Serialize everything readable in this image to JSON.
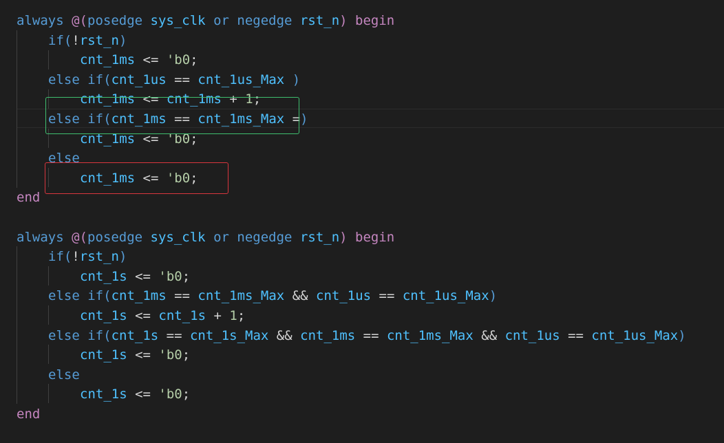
{
  "colors": {
    "background": "#1e1e1e",
    "keyword": "#569cd6",
    "control": "#c586c0",
    "variable": "#4fc1ff",
    "number": "#b5cea8",
    "operator": "#d4d4d4",
    "annotation_green": "#3fbf6f",
    "annotation_red": "#d9363e"
  },
  "code": {
    "lines": [
      {
        "indent": 0,
        "tokens": [
          [
            "always",
            "tok-kw"
          ],
          [
            " ",
            ""
          ],
          [
            "@",
            "tok-at"
          ],
          [
            "(",
            "tok-brk2"
          ],
          [
            "posedge",
            "tok-kw"
          ],
          [
            " ",
            ""
          ],
          [
            "sys_clk",
            "tok-var"
          ],
          [
            " ",
            ""
          ],
          [
            "or",
            "tok-kw"
          ],
          [
            " ",
            ""
          ],
          [
            "negedge",
            "tok-kw"
          ],
          [
            " ",
            ""
          ],
          [
            "rst_n",
            "tok-var"
          ],
          [
            ")",
            "tok-brk2"
          ],
          [
            " ",
            ""
          ],
          [
            "begin",
            "tok-ctrl"
          ]
        ]
      },
      {
        "indent": 1,
        "tokens": [
          [
            "if",
            "tok-kw"
          ],
          [
            "(",
            "tok-brk"
          ],
          [
            "!",
            "tok-op"
          ],
          [
            "rst_n",
            "tok-var"
          ],
          [
            ")",
            "tok-brk"
          ]
        ]
      },
      {
        "indent": 2,
        "tokens": [
          [
            "cnt_1ms",
            "tok-var"
          ],
          [
            " <= ",
            "tok-op"
          ],
          [
            "'b0",
            "tok-num"
          ],
          [
            ";",
            "tok-op"
          ]
        ]
      },
      {
        "indent": 1,
        "tokens": [
          [
            "else",
            "tok-kw"
          ],
          [
            " ",
            ""
          ],
          [
            "if",
            "tok-kw"
          ],
          [
            "(",
            "tok-brk"
          ],
          [
            "cnt_1us",
            "tok-var"
          ],
          [
            " == ",
            "tok-op"
          ],
          [
            "cnt_1us_Max",
            "tok-var"
          ],
          [
            " ",
            ""
          ],
          [
            ")",
            "tok-brk"
          ]
        ]
      },
      {
        "indent": 2,
        "tokens": [
          [
            "cnt_1ms",
            "tok-var"
          ],
          [
            " <= ",
            "tok-op"
          ],
          [
            "cnt_1ms",
            "tok-var"
          ],
          [
            " + ",
            "tok-op"
          ],
          [
            "1",
            "tok-num"
          ],
          [
            ";",
            "tok-op"
          ]
        ]
      },
      {
        "indent": 1,
        "tokens": [
          [
            "else",
            "tok-kw"
          ],
          [
            " ",
            ""
          ],
          [
            "if",
            "tok-kw"
          ],
          [
            "(",
            "tok-brk"
          ],
          [
            "cnt_1ms",
            "tok-var"
          ],
          [
            " == ",
            "tok-op"
          ],
          [
            "cnt_1ms_Max",
            "tok-var"
          ],
          [
            " ",
            ""
          ],
          [
            "=",
            "tok-op"
          ],
          [
            ")",
            "tok-brk"
          ]
        ]
      },
      {
        "indent": 2,
        "tokens": [
          [
            "cnt_1ms",
            "tok-var"
          ],
          [
            " <= ",
            "tok-op"
          ],
          [
            "'b0",
            "tok-num"
          ],
          [
            ";",
            "tok-op"
          ]
        ]
      },
      {
        "indent": 1,
        "tokens": [
          [
            "else",
            "tok-kw"
          ]
        ]
      },
      {
        "indent": 2,
        "tokens": [
          [
            "cnt_1ms",
            "tok-var"
          ],
          [
            " <= ",
            "tok-op"
          ],
          [
            "'b0",
            "tok-num"
          ],
          [
            ";",
            "tok-op"
          ]
        ]
      },
      {
        "indent": 0,
        "tokens": [
          [
            "end",
            "tok-ctrl"
          ]
        ]
      },
      {
        "indent": 0,
        "tokens": []
      },
      {
        "indent": 0,
        "tokens": [
          [
            "always",
            "tok-kw"
          ],
          [
            " ",
            ""
          ],
          [
            "@",
            "tok-at"
          ],
          [
            "(",
            "tok-brk2"
          ],
          [
            "posedge",
            "tok-kw"
          ],
          [
            " ",
            ""
          ],
          [
            "sys_clk",
            "tok-var"
          ],
          [
            " ",
            ""
          ],
          [
            "or",
            "tok-kw"
          ],
          [
            " ",
            ""
          ],
          [
            "negedge",
            "tok-kw"
          ],
          [
            " ",
            ""
          ],
          [
            "rst_n",
            "tok-var"
          ],
          [
            ")",
            "tok-brk2"
          ],
          [
            " ",
            ""
          ],
          [
            "begin",
            "tok-ctrl"
          ]
        ]
      },
      {
        "indent": 1,
        "tokens": [
          [
            "if",
            "tok-kw"
          ],
          [
            "(",
            "tok-brk"
          ],
          [
            "!",
            "tok-op"
          ],
          [
            "rst_n",
            "tok-var"
          ],
          [
            ")",
            "tok-brk"
          ]
        ]
      },
      {
        "indent": 2,
        "tokens": [
          [
            "cnt_1s",
            "tok-var"
          ],
          [
            " <= ",
            "tok-op"
          ],
          [
            "'b0",
            "tok-num"
          ],
          [
            ";",
            "tok-op"
          ]
        ]
      },
      {
        "indent": 1,
        "tokens": [
          [
            "else",
            "tok-kw"
          ],
          [
            " ",
            ""
          ],
          [
            "if",
            "tok-kw"
          ],
          [
            "(",
            "tok-brk"
          ],
          [
            "cnt_1ms",
            "tok-var"
          ],
          [
            " == ",
            "tok-op"
          ],
          [
            "cnt_1ms_Max",
            "tok-var"
          ],
          [
            " && ",
            "tok-op"
          ],
          [
            "cnt_1us",
            "tok-var"
          ],
          [
            " == ",
            "tok-op"
          ],
          [
            "cnt_1us_Max",
            "tok-var"
          ],
          [
            ")",
            "tok-brk"
          ]
        ]
      },
      {
        "indent": 2,
        "tokens": [
          [
            "cnt_1s",
            "tok-var"
          ],
          [
            " <= ",
            "tok-op"
          ],
          [
            "cnt_1s",
            "tok-var"
          ],
          [
            " + ",
            "tok-op"
          ],
          [
            "1",
            "tok-num"
          ],
          [
            ";",
            "tok-op"
          ]
        ]
      },
      {
        "indent": 1,
        "tokens": [
          [
            "else",
            "tok-kw"
          ],
          [
            " ",
            ""
          ],
          [
            "if",
            "tok-kw"
          ],
          [
            "(",
            "tok-brk"
          ],
          [
            "cnt_1s",
            "tok-var"
          ],
          [
            " == ",
            "tok-op"
          ],
          [
            "cnt_1s_Max",
            "tok-var"
          ],
          [
            " && ",
            "tok-op"
          ],
          [
            "cnt_1ms",
            "tok-var"
          ],
          [
            " == ",
            "tok-op"
          ],
          [
            "cnt_1ms_Max",
            "tok-var"
          ],
          [
            " && ",
            "tok-op"
          ],
          [
            "cnt_1us",
            "tok-var"
          ],
          [
            " == ",
            "tok-op"
          ],
          [
            "cnt_1us_Max",
            "tok-var"
          ],
          [
            ")",
            "tok-brk"
          ]
        ]
      },
      {
        "indent": 2,
        "tokens": [
          [
            "cnt_1s",
            "tok-var"
          ],
          [
            " <= ",
            "tok-op"
          ],
          [
            "'b0",
            "tok-num"
          ],
          [
            ";",
            "tok-op"
          ]
        ]
      },
      {
        "indent": 1,
        "tokens": [
          [
            "else",
            "tok-kw"
          ]
        ]
      },
      {
        "indent": 2,
        "tokens": [
          [
            "cnt_1s",
            "tok-var"
          ],
          [
            " <= ",
            "tok-op"
          ],
          [
            "'b0",
            "tok-num"
          ],
          [
            ";",
            "tok-op"
          ]
        ]
      },
      {
        "indent": 0,
        "tokens": [
          [
            "end",
            "tok-ctrl"
          ]
        ]
      }
    ]
  }
}
